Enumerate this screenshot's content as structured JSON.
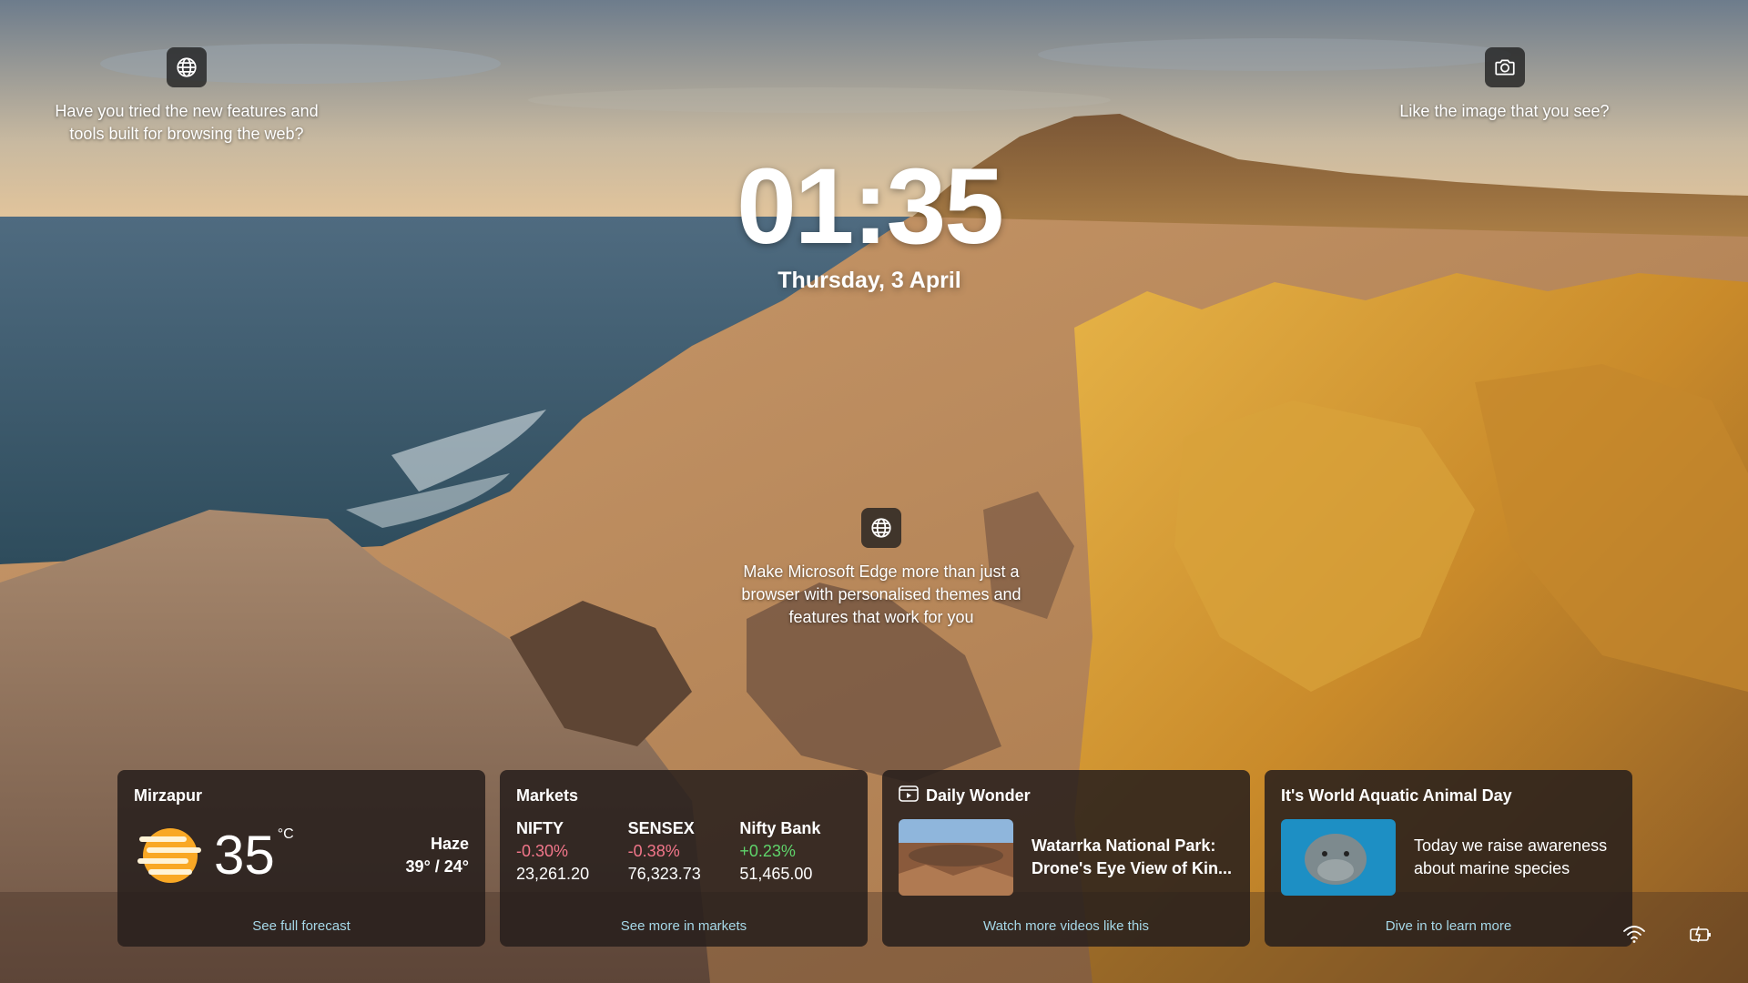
{
  "hotspots": {
    "browse": {
      "icon": "globe-icon",
      "text": "Have you tried the new features and tools built for browsing the web?"
    },
    "image": {
      "icon": "camera-icon",
      "text": "Like the image that you see?"
    },
    "edge": {
      "icon": "globe-icon",
      "text": "Make Microsoft Edge more than just a browser with personalised themes and features that work for you"
    }
  },
  "clock": {
    "time": "01:35",
    "date": "Thursday, 3 April"
  },
  "weather": {
    "location": "Mirzapur",
    "icon": "haze-sun-icon",
    "temperature": "35",
    "unit": "°C",
    "condition": "Haze",
    "high_low": "39° / 24°",
    "footer": "See full forecast"
  },
  "markets": {
    "title": "Markets",
    "items": [
      {
        "name": "NIFTY",
        "change": "-0.30%",
        "value": "23,261.20",
        "direction": "down"
      },
      {
        "name": "SENSEX",
        "change": "-0.38%",
        "value": "76,323.73",
        "direction": "down"
      },
      {
        "name": "Nifty Bank",
        "change": "+0.23%",
        "value": "51,465.00",
        "direction": "up"
      }
    ],
    "footer": "See more in markets"
  },
  "wonder": {
    "title": "Daily Wonder",
    "icon": "video-icon",
    "headline": "Watarrka National Park: Drone's Eye View of Kin...",
    "footer": "Watch more videos like this"
  },
  "aquatic": {
    "title": "It's World Aquatic Animal Day",
    "description": "Today we raise awareness about marine species",
    "footer": "Dive in to learn more"
  },
  "tray": {
    "wifi_icon": "wifi-icon",
    "battery_icon": "battery-charging-icon"
  },
  "colors": {
    "negative": "#f2768a",
    "positive": "#5fd46b",
    "link": "#a6d8e8",
    "card_bg": "rgba(38,30,28,0.86)"
  }
}
